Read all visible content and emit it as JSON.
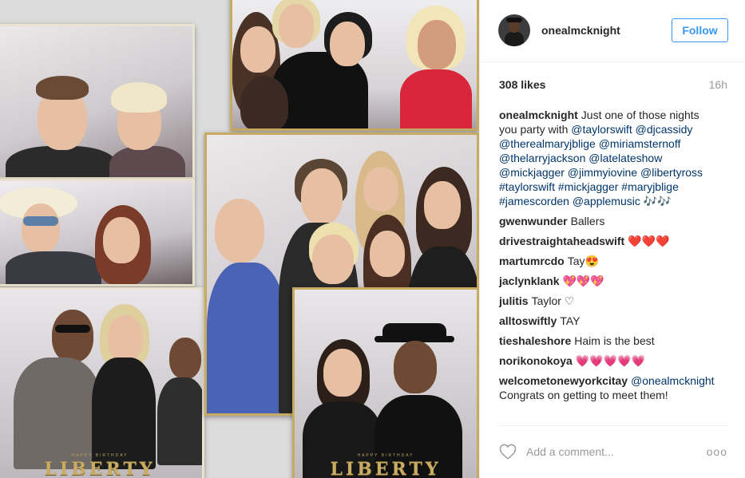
{
  "post": {
    "username": "onealmcknight",
    "follow_label": "Follow",
    "likes": "308 likes",
    "time_ago": "16h",
    "photo_brand_text": "LIBERTY",
    "photo_banner_text": "HAPPY BIRTHDAY",
    "caption": {
      "user": "onealmcknight",
      "lines": [
        [
          {
            "t": "Just one of those nights"
          }
        ],
        [
          {
            "t": "you party with "
          },
          {
            "t": "@taylorswift",
            "link": true
          },
          {
            "t": " "
          },
          {
            "t": "@djcassidy",
            "link": true
          }
        ],
        [
          {
            "t": "@therealmaryjblige",
            "link": true
          },
          {
            "t": " "
          },
          {
            "t": "@miriamsternoff",
            "link": true
          }
        ],
        [
          {
            "t": "@thelarryjackson",
            "link": true
          },
          {
            "t": " "
          },
          {
            "t": "@latelateshow",
            "link": true
          }
        ],
        [
          {
            "t": "@mickjagger",
            "link": true
          },
          {
            "t": " "
          },
          {
            "t": "@jimmyiovine",
            "link": true
          },
          {
            "t": " "
          },
          {
            "t": "@libertyross",
            "link": true
          }
        ],
        [
          {
            "t": "#taylorswift",
            "link": true
          },
          {
            "t": " "
          },
          {
            "t": "#mickjagger",
            "link": true
          },
          {
            "t": " "
          },
          {
            "t": "#maryjblige",
            "link": true
          }
        ],
        [
          {
            "t": "#jamescorden",
            "link": true
          },
          {
            "t": " "
          },
          {
            "t": "@applemusic",
            "link": true
          },
          {
            "t": " 🎶🎶"
          }
        ]
      ]
    },
    "comments": [
      {
        "user": "gwenwunder",
        "text": "Ballers"
      },
      {
        "user": "drivestraightaheadswift",
        "text": "❤️❤️❤️"
      },
      {
        "user": "martumrcdo",
        "text": "Tay😍"
      },
      {
        "user": "jaclynklank",
        "text": "💖💖💖"
      },
      {
        "user": "julitis",
        "text": "Taylor ♡"
      },
      {
        "user": "alltoswiftly",
        "text": "TAY"
      },
      {
        "user": "tieshaleshore",
        "text": "Haim is the best"
      },
      {
        "user": "norikonokoya",
        "text": "💗💗💗💗💗"
      },
      {
        "user": "welcometonewyorkcitay",
        "text_parts": [
          {
            "t": "@onealmcknight",
            "link": true
          }
        ],
        "text_line2": "Congrats on getting to meet them!"
      }
    ],
    "add_comment_placeholder": "Add a comment...",
    "more_options": "ooo"
  },
  "icons": {
    "like": "heart-outline-icon",
    "more": "more-options-icon",
    "avatar": "user-avatar"
  },
  "colors": {
    "link": "#003569",
    "follow": "#3897f0",
    "muted": "#999999",
    "text": "#262626",
    "divider": "#efefef"
  }
}
